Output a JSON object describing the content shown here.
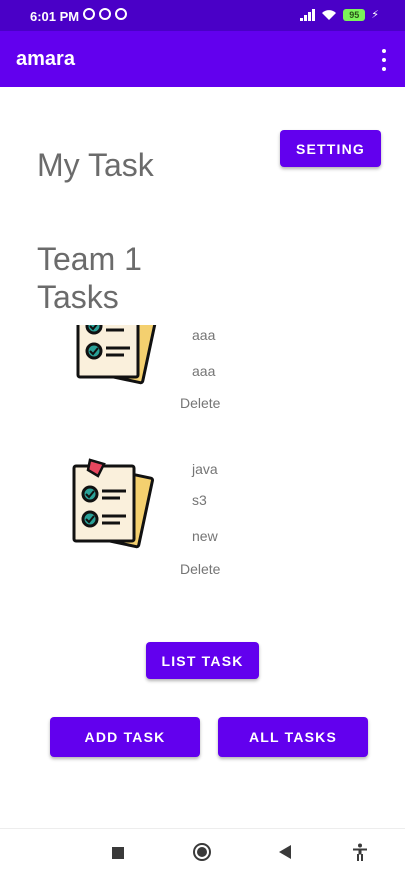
{
  "status_bar": {
    "time": "6:01 PM",
    "battery": "95"
  },
  "app_bar": {
    "title": "amara"
  },
  "buttons": {
    "setting": "SETTING",
    "list_task": "LIST TASK",
    "add_task": "ADD TASK",
    "all_tasks": "ALL TASKS"
  },
  "headings": {
    "my_task": "My Task",
    "team_tasks": "Team 1 Tasks"
  },
  "tasks": [
    {
      "title": "aaa",
      "body": "aaa",
      "state": "",
      "delete": "Delete"
    },
    {
      "title": "java",
      "body": "s3",
      "state": "new",
      "delete": "Delete"
    }
  ],
  "icons": {
    "task": "task-list-icon",
    "overflow": "more-vert-icon",
    "nav_recent": "square-icon",
    "nav_home": "home-circle-icon",
    "nav_back": "back-triangle-icon",
    "nav_accessibility": "accessibility-icon"
  },
  "colors": {
    "primary": "#6200ee",
    "status_bar": "#4a00c7",
    "text_gray": "#757575"
  }
}
